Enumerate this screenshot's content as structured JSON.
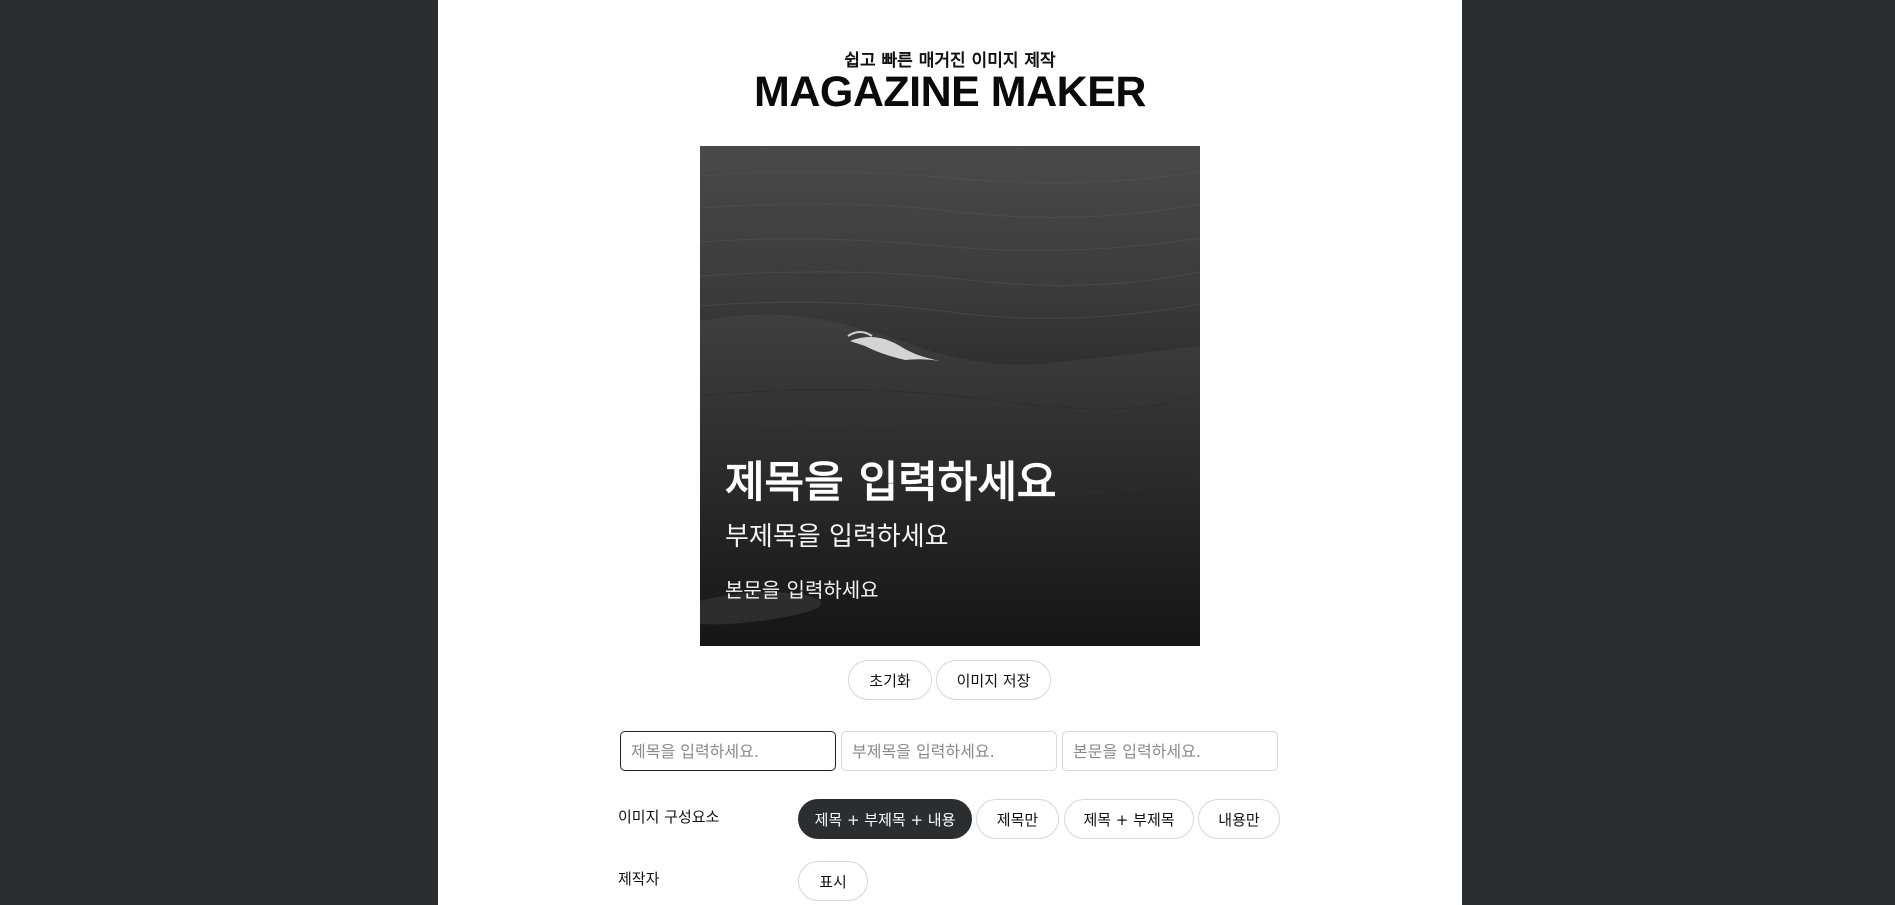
{
  "header": {
    "subtitle": "쉽고 빠른 매거진 이미지 제작",
    "title": "MAGAZINE MAKER"
  },
  "preview": {
    "title": "제목을 입력하세요",
    "subtitle": "부제목을 입력하세요",
    "body": "본문을 입력하세요"
  },
  "actions": {
    "reset_label": "초기화",
    "save_label": "이미지 저장"
  },
  "inputs": {
    "title_placeholder": "제목을 입력하세요.",
    "subtitle_placeholder": "부제목을 입력하세요.",
    "body_placeholder": "본문을 입력하세요."
  },
  "composition": {
    "label": "이미지 구성요소",
    "options": [
      {
        "label": "제목 + 부제목 + 내용",
        "active": true
      },
      {
        "label": "제목만",
        "active": false
      },
      {
        "label": "제목 + 부제목",
        "active": false
      },
      {
        "label": "내용만",
        "active": false
      }
    ]
  },
  "author": {
    "label": "제작자",
    "toggle_label": "표시"
  },
  "colors": {
    "background": "#2b2e31",
    "active_pill": "#2b2e31"
  }
}
